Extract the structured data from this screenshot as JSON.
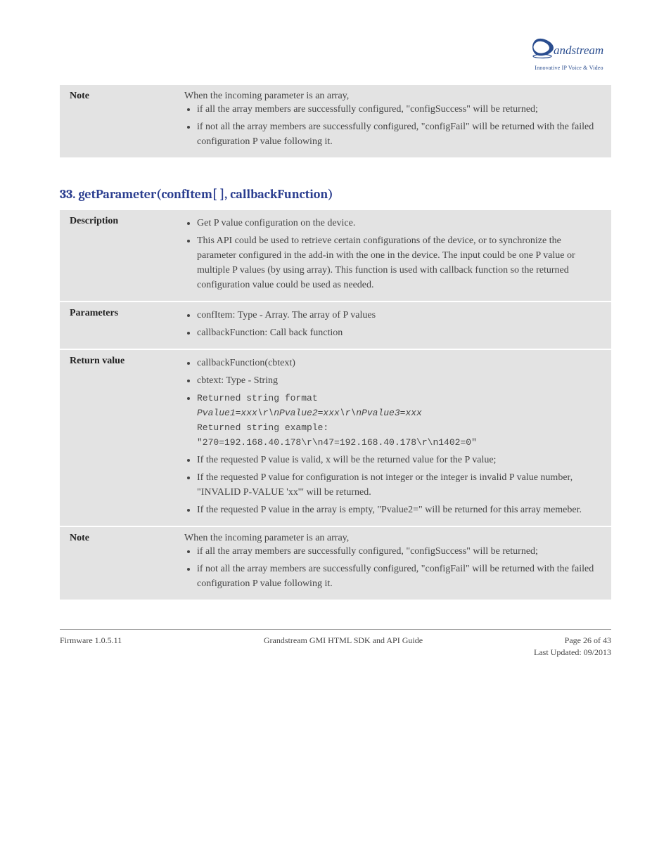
{
  "logo_text": "andstream",
  "logo_tag": "Innovative IP Voice & Video",
  "top_table": {
    "label": "Note",
    "intro": "When the incoming parameter is an array,",
    "items": [
      "if all the array members are successfully configured, \"configSuccess\" will be returned;",
      "if not all the array members are successfully configured, \"configFail\" will be returned with the failed configuration P value following it."
    ]
  },
  "section_heading": "33. getParameter(confItem[ ], callbackFunction)",
  "sec33": {
    "rows": [
      {
        "label": "Description",
        "items": [
          "Get P value configuration on the device.",
          "This API could be used to retrieve certain configurations of the device, or to synchronize the parameter configured in the add-in with the one in the device. The input could be one P value or multiple P values (by using array). This function is used with callback function so the returned configuration value could be used as needed."
        ]
      },
      {
        "label": "Parameters",
        "items": [
          "confItem: Type - Array. The array of P values",
          "callbackFunction: Call back function"
        ]
      },
      {
        "label": "Return value",
        "items": [
          "callbackFunction(cbtext)",
          "cbtext: Type - String",
          "Returned string format Pvalue1=xxx\\r\\nPvalue2=xxx\\r\\nPvalue3=xxx",
          "Returned string example: \"270=192.168.40.178\\r\\n47=192.168.40.178\\r\\n1402=0\"",
          "If the requested P value is valid, x will be the returned value for the P value;",
          "If the requested P value for configuration is not integer or the integer is invalid P value number, \"INVALID P-VALUE 'xx'\" will be returned.",
          "If the requested P value in the array is empty, \"Pvalue2=\" will be returned for this array memeber."
        ]
      },
      {
        "label": "Note",
        "intro": "When the incoming parameter is an array,",
        "items": [
          "if all the array members are successfully configured, \"configSuccess\" will be returned;",
          "if not all the array members are successfully configured, \"configFail\" will be returned with the failed configuration P value following it."
        ]
      }
    ]
  },
  "footer": {
    "left": "Firmware 1.0.5.11",
    "center": "Grandstream GMI HTML SDK and API Guide",
    "right_line1": "Page 26 of 43",
    "right_line2": "Last Updated: 09/2013"
  }
}
